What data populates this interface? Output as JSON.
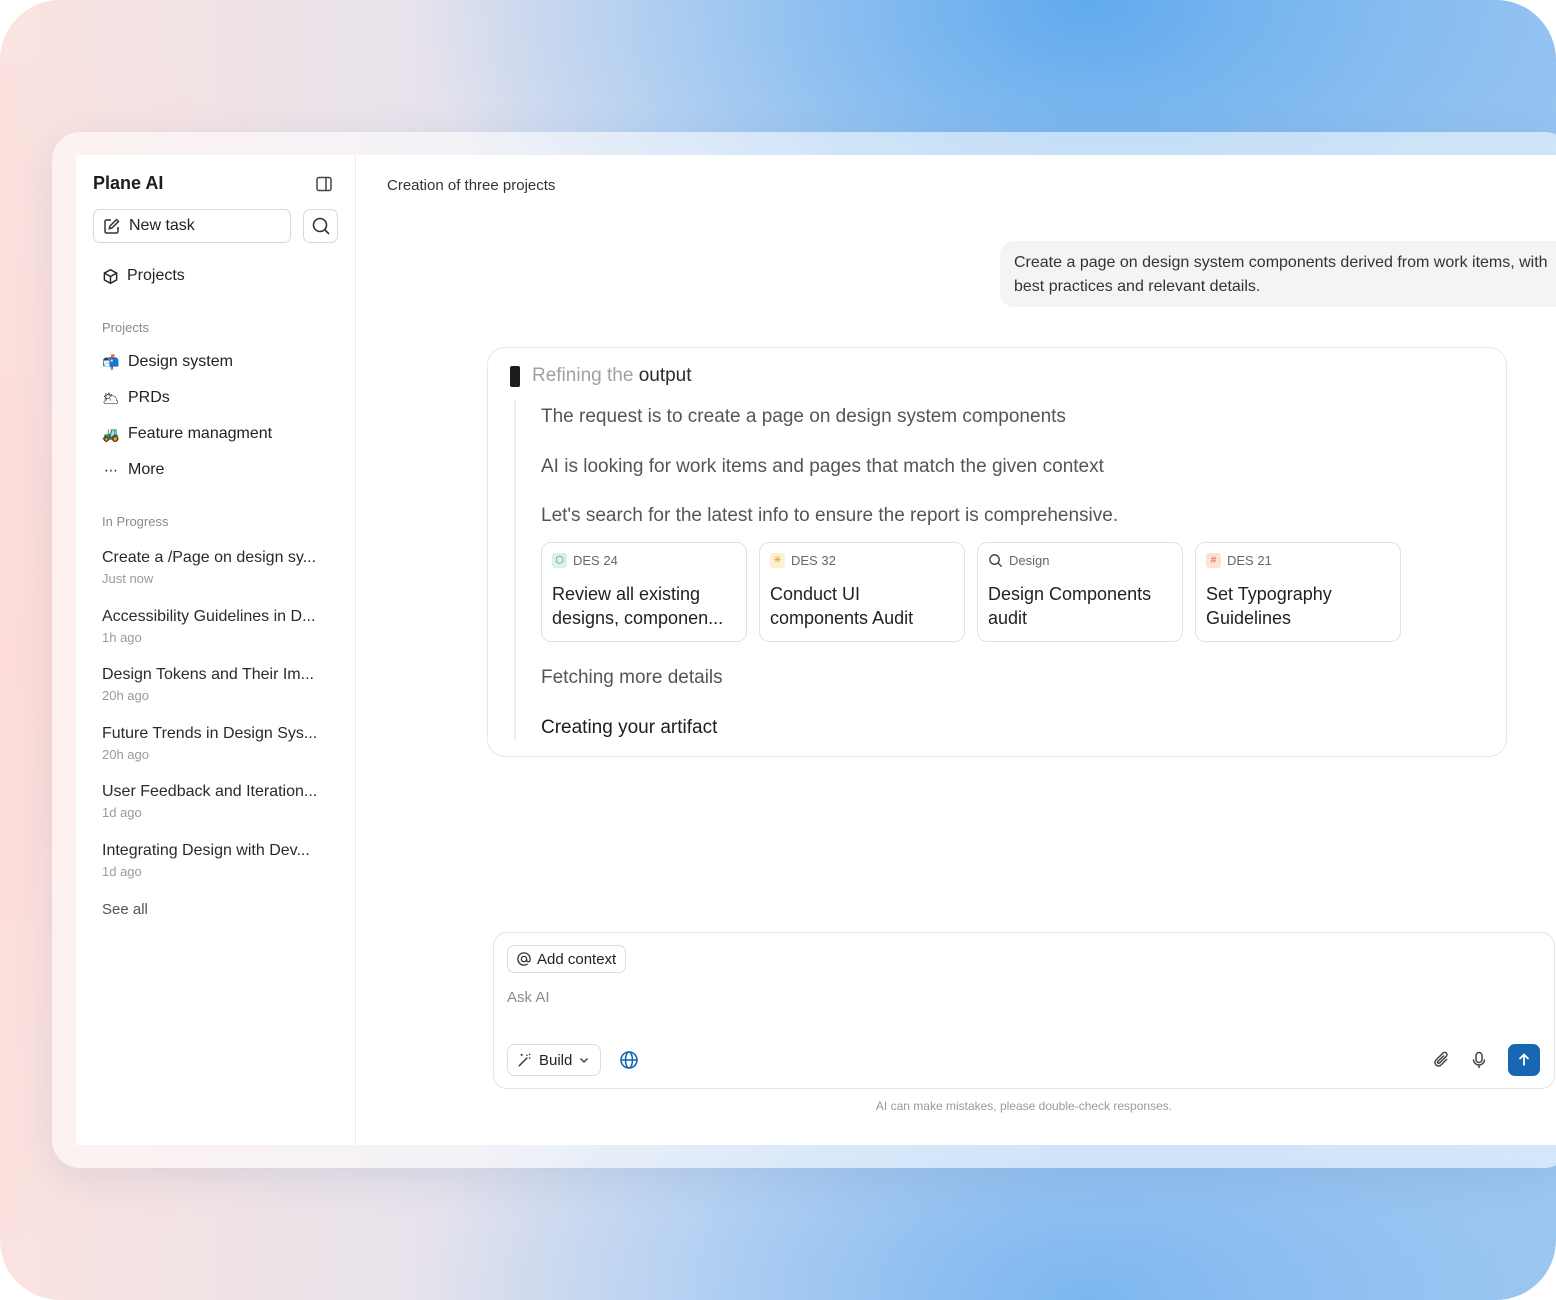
{
  "app": {
    "title": "Plane AI"
  },
  "sidebar": {
    "new_task_label": "New task",
    "nav_projects_label": "Projects",
    "projects_section_label": "Projects",
    "projects": [
      {
        "emoji": "📬",
        "label": "Design system"
      },
      {
        "emoji": "🌥",
        "label": "PRDs"
      },
      {
        "emoji": "🚜",
        "label": "Feature managment"
      },
      {
        "emoji": "⋯",
        "label": "More"
      }
    ],
    "in_progress_label": "In Progress",
    "tasks": [
      {
        "title": "Create a /Page on design sy...",
        "time": "Just now"
      },
      {
        "title": "Accessibility Guidelines in D...",
        "time": "1h ago"
      },
      {
        "title": "Design Tokens and Their Im...",
        "time": "20h ago"
      },
      {
        "title": "Future Trends in Design Sys...",
        "time": "20h ago"
      },
      {
        "title": "User Feedback and Iteration...",
        "time": "1d ago"
      },
      {
        "title": "Integrating Design with Dev...",
        "time": "1d ago"
      }
    ],
    "see_all_label": "See all"
  },
  "main": {
    "page_title": "Creation of three projects",
    "user_message": "Create a page on design system components derived from work items, with best practices and relevant details.",
    "status_gray": "Refining the",
    "status_dark": "output",
    "steps": [
      "The request is to create a page on design system components",
      "AI is looking for work items and pages that match the given context",
      "Let's search for the latest info to ensure the report is comprehensive."
    ],
    "work_items": [
      {
        "id": "DES 24",
        "badge": "⬡",
        "badge_color": "#d9f2e6",
        "badge_fg": "#2f9e6a",
        "title": "Review all existing designs, componen..."
      },
      {
        "id": "DES 32",
        "badge": "✳",
        "badge_color": "#fdf0d2",
        "badge_fg": "#d79b22",
        "title": "Conduct UI components Audit"
      },
      {
        "id": "Design",
        "badge": "search",
        "badge_color": "#ffffff",
        "badge_fg": "#444444",
        "title": "Design Components audit"
      },
      {
        "id": "DES 21",
        "badge": "#",
        "badge_color": "#fde1d8",
        "badge_fg": "#e0653a",
        "title": "Set Typography Guidelines"
      }
    ],
    "fetching": "Fetching more details",
    "creating": "Creating your artifact"
  },
  "composer": {
    "add_context_label": "Add context",
    "placeholder": "Ask AI",
    "build_label": "Build",
    "disclaimer": "AI can make mistakes, please double-check responses."
  },
  "colors": {
    "accent": "#1767b3"
  }
}
